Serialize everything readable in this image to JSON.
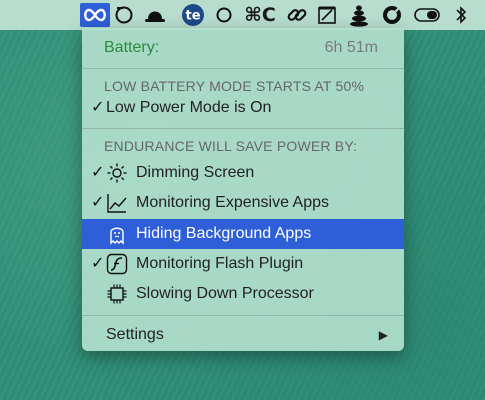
{
  "menubar": {
    "items": [
      {
        "name": "endurance-infinity-icon",
        "active": true
      },
      {
        "name": "bracket-circle-icon"
      },
      {
        "name": "bowler-hat-icon"
      },
      {
        "name": "te-badge-icon",
        "text": "te"
      },
      {
        "name": "circle-icon"
      },
      {
        "name": "command-c-icon",
        "text": "⌘C"
      },
      {
        "name": "link-icon"
      },
      {
        "name": "edit-note-icon"
      },
      {
        "name": "stacked-stones-icon"
      },
      {
        "name": "ring-icon"
      },
      {
        "name": "toggle-icon"
      },
      {
        "name": "bluetooth-icon"
      }
    ]
  },
  "menu": {
    "battery_label": "Battery:",
    "battery_time": "6h 51m",
    "low_battery_header": "LOW BATTERY MODE STARTS AT 50%",
    "low_power_label": "Low Power Mode is On",
    "endurance_header": "ENDURANCE WILL SAVE POWER BY:",
    "items": [
      {
        "label": "Dimming Screen",
        "checked": true,
        "icon": "sun-icon"
      },
      {
        "label": "Monitoring Expensive Apps",
        "checked": true,
        "icon": "chart-line-icon"
      },
      {
        "label": "Hiding Background Apps",
        "checked": false,
        "icon": "ghost-icon",
        "selected": true
      },
      {
        "label": "Monitoring Flash Plugin",
        "checked": true,
        "icon": "flash-plugin-icon"
      },
      {
        "label": "Slowing Down Processor",
        "checked": false,
        "icon": "cpu-chip-icon"
      }
    ],
    "settings_label": "Settings",
    "checkmark": "✓",
    "submenu_arrow": "▶"
  },
  "colors": {
    "selection": "#2f5fd8",
    "battery_label": "#2c8a3a"
  }
}
